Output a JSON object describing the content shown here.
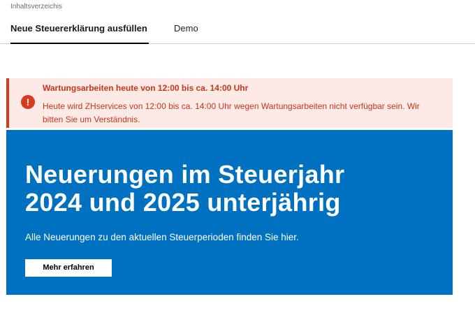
{
  "toc": {
    "label": "Inhaltsverzeichis"
  },
  "tabs": [
    {
      "label": "Neue Steuererklärung ausfüllen",
      "active": true
    },
    {
      "label": "Demo",
      "active": false
    }
  ],
  "alert": {
    "icon": "alert-circle-icon",
    "icon_glyph": "!",
    "title": "Wartungsarbeiten heute von 12:00 bis ca. 14:00 Uhr",
    "text": "Heute wird ZHservices von 12:00 bis ca. 14:00 Uhr wegen Wartungsarbeiten nicht verfügbar sein. Wir bitten Sie um Verständnis.",
    "color": "#d93c1c",
    "background": "#fde9e6"
  },
  "hero": {
    "title_line1": "Neuerungen im Steuerjahr",
    "title_line2": "2024 und 2025 unterjährig",
    "subtitle": "Alle Neuerungen zu den aktuellen Steuerperioden finden Sie hier.",
    "button_label": "Mehr erfahren",
    "background": "#0070c0"
  }
}
